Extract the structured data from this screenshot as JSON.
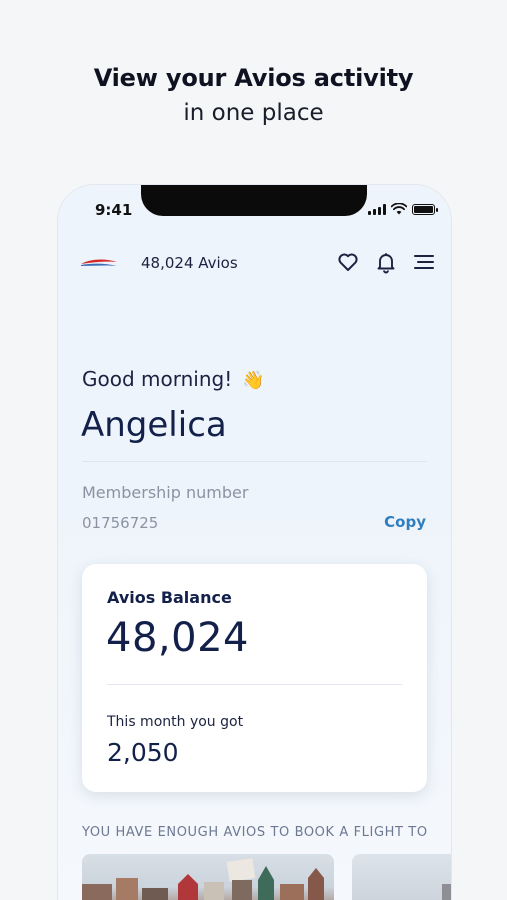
{
  "promo": {
    "line1": "View your Avios activity",
    "line2": "in one place"
  },
  "status_bar": {
    "time": "9:41"
  },
  "header": {
    "avios_balance_label": "48,024 Avios",
    "icons": [
      "ba-logo",
      "heart-icon",
      "bell-icon",
      "menu-icon"
    ]
  },
  "greeting": {
    "text": "Good morning!",
    "emoji": "👋",
    "name": "Angelica"
  },
  "membership": {
    "label": "Membership number",
    "number": "01756725",
    "copy_label": "Copy"
  },
  "balance_card": {
    "label": "Avios Balance",
    "value": "48,024",
    "month_label": "This month you got",
    "month_value": "2,050"
  },
  "destinations": {
    "heading": "YOU HAVE ENOUGH AVIOS TO BOOK A FLIGHT TO"
  },
  "colors": {
    "accent": "#2f7ec0",
    "navy": "#12204a",
    "ba_red": "#d62a2a",
    "ba_blue": "#3b6fb6"
  }
}
